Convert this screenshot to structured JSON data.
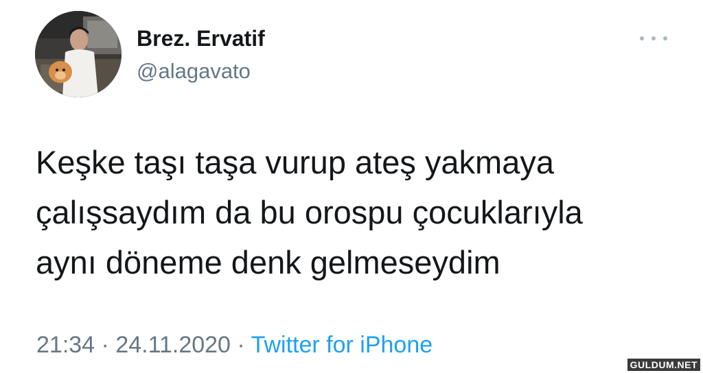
{
  "author": {
    "display_name": "Brez. Ervatif",
    "handle": "@alagavato",
    "avatar_icon": "profile-photo"
  },
  "more_icon": "more-horizontal-icon",
  "tweet": {
    "lines": [
      "Keşke taşı taşa vurup ateş yakmaya",
      "çalışsaydım da bu orospu çocuklarıyla",
      "aynı döneme denk gelmeseydim"
    ]
  },
  "meta": {
    "time": "21:34",
    "separator": " · ",
    "date": "24.11.2020",
    "source": "Twitter for iPhone"
  },
  "watermark": "GULDUM.NET",
  "colors": {
    "text": "#14171a",
    "secondary": "#657786",
    "link": "#1da1f2"
  }
}
